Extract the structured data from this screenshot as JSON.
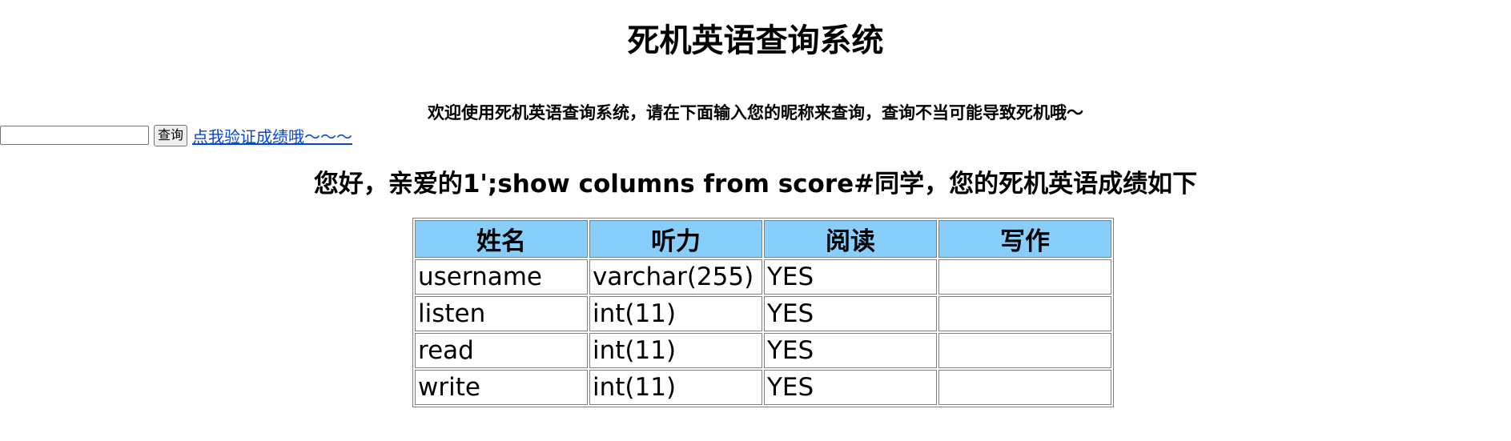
{
  "page": {
    "title": "死机英语查询系统",
    "subtitle": "欢迎使用死机英语查询系统，请在下面输入您的昵称来查询，查询不当可能导致死机哦～"
  },
  "search": {
    "value": "",
    "placeholder": "",
    "button_label": "查询",
    "link_text": "点我验证成绩哦～～～"
  },
  "result": {
    "greeting": "您好，亲爱的1';show columns from score#同学，您的死机英语成绩如下"
  },
  "table": {
    "headers": [
      "姓名",
      "听力",
      "阅读",
      "写作"
    ],
    "rows": [
      [
        "username",
        "varchar(255)",
        "YES",
        ""
      ],
      [
        "listen",
        "int(11)",
        "YES",
        ""
      ],
      [
        "read",
        "int(11)",
        "YES",
        ""
      ],
      [
        "write",
        "int(11)",
        "YES",
        ""
      ]
    ]
  },
  "colors": {
    "header_bg": "#87cefa",
    "link": "#0645d6",
    "border": "#808080"
  }
}
